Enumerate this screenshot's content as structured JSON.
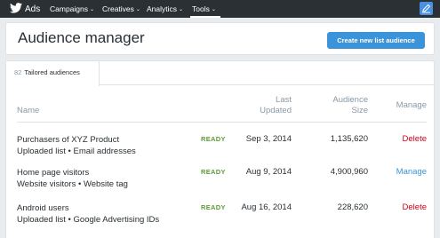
{
  "topbar": {
    "brand": "Ads",
    "nav": [
      {
        "label": "Campaigns"
      },
      {
        "label": "Creatives"
      },
      {
        "label": "Analytics"
      },
      {
        "label": "Tools"
      }
    ],
    "caret": "⌄",
    "active_nav": "Tools"
  },
  "header": {
    "title": "Audience manager",
    "create_button": "Create new list audience"
  },
  "tabs": [
    {
      "count": "82",
      "label": "Tailored audiences"
    }
  ],
  "table": {
    "columns": {
      "name": "Name",
      "updated": [
        "Last",
        "Updated"
      ],
      "size": [
        "Audience",
        "Size"
      ],
      "manage": "Manage"
    },
    "rows": [
      {
        "title": "Purchasers of XYZ Product",
        "subtitle": "Uploaded list • Email addresses",
        "status": "READY",
        "updated": "Sep 3, 2014",
        "size": "1,135,620",
        "action": "Delete"
      },
      {
        "title": "Home page visitors",
        "subtitle": "Website visitors • Website tag",
        "status": "READY",
        "updated": "Aug 9, 2014",
        "size": "4,900,960",
        "action": "Manage"
      },
      {
        "title": "Android users",
        "subtitle": "Uploaded list • Google Advertising IDs",
        "status": "READY",
        "updated": "Aug 16, 2014",
        "size": "228,620",
        "action": "Delete"
      }
    ]
  },
  "colors": {
    "topbar": "#2b3035",
    "primary": "#3b94d9",
    "ready": "#5d9a3a",
    "delete": "#d0021b"
  }
}
